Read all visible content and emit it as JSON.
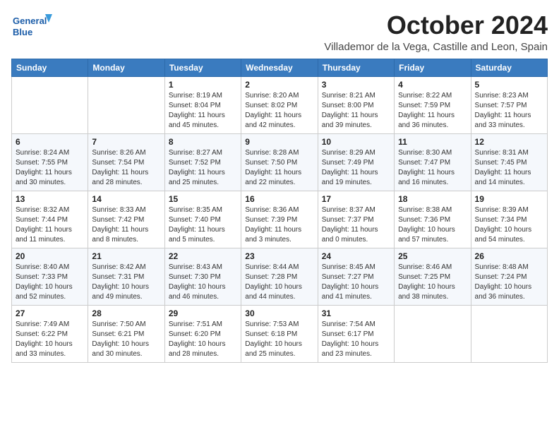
{
  "header": {
    "logo_text_general": "General",
    "logo_text_blue": "Blue",
    "month_title": "October 2024",
    "subtitle": "Villademor de la Vega, Castille and Leon, Spain"
  },
  "weekdays": [
    "Sunday",
    "Monday",
    "Tuesday",
    "Wednesday",
    "Thursday",
    "Friday",
    "Saturday"
  ],
  "weeks": [
    [
      {
        "day": "",
        "info": ""
      },
      {
        "day": "",
        "info": ""
      },
      {
        "day": "1",
        "info": "Sunrise: 8:19 AM\nSunset: 8:04 PM\nDaylight: 11 hours and 45 minutes."
      },
      {
        "day": "2",
        "info": "Sunrise: 8:20 AM\nSunset: 8:02 PM\nDaylight: 11 hours and 42 minutes."
      },
      {
        "day": "3",
        "info": "Sunrise: 8:21 AM\nSunset: 8:00 PM\nDaylight: 11 hours and 39 minutes."
      },
      {
        "day": "4",
        "info": "Sunrise: 8:22 AM\nSunset: 7:59 PM\nDaylight: 11 hours and 36 minutes."
      },
      {
        "day": "5",
        "info": "Sunrise: 8:23 AM\nSunset: 7:57 PM\nDaylight: 11 hours and 33 minutes."
      }
    ],
    [
      {
        "day": "6",
        "info": "Sunrise: 8:24 AM\nSunset: 7:55 PM\nDaylight: 11 hours and 30 minutes."
      },
      {
        "day": "7",
        "info": "Sunrise: 8:26 AM\nSunset: 7:54 PM\nDaylight: 11 hours and 28 minutes."
      },
      {
        "day": "8",
        "info": "Sunrise: 8:27 AM\nSunset: 7:52 PM\nDaylight: 11 hours and 25 minutes."
      },
      {
        "day": "9",
        "info": "Sunrise: 8:28 AM\nSunset: 7:50 PM\nDaylight: 11 hours and 22 minutes."
      },
      {
        "day": "10",
        "info": "Sunrise: 8:29 AM\nSunset: 7:49 PM\nDaylight: 11 hours and 19 minutes."
      },
      {
        "day": "11",
        "info": "Sunrise: 8:30 AM\nSunset: 7:47 PM\nDaylight: 11 hours and 16 minutes."
      },
      {
        "day": "12",
        "info": "Sunrise: 8:31 AM\nSunset: 7:45 PM\nDaylight: 11 hours and 14 minutes."
      }
    ],
    [
      {
        "day": "13",
        "info": "Sunrise: 8:32 AM\nSunset: 7:44 PM\nDaylight: 11 hours and 11 minutes."
      },
      {
        "day": "14",
        "info": "Sunrise: 8:33 AM\nSunset: 7:42 PM\nDaylight: 11 hours and 8 minutes."
      },
      {
        "day": "15",
        "info": "Sunrise: 8:35 AM\nSunset: 7:40 PM\nDaylight: 11 hours and 5 minutes."
      },
      {
        "day": "16",
        "info": "Sunrise: 8:36 AM\nSunset: 7:39 PM\nDaylight: 11 hours and 3 minutes."
      },
      {
        "day": "17",
        "info": "Sunrise: 8:37 AM\nSunset: 7:37 PM\nDaylight: 11 hours and 0 minutes."
      },
      {
        "day": "18",
        "info": "Sunrise: 8:38 AM\nSunset: 7:36 PM\nDaylight: 10 hours and 57 minutes."
      },
      {
        "day": "19",
        "info": "Sunrise: 8:39 AM\nSunset: 7:34 PM\nDaylight: 10 hours and 54 minutes."
      }
    ],
    [
      {
        "day": "20",
        "info": "Sunrise: 8:40 AM\nSunset: 7:33 PM\nDaylight: 10 hours and 52 minutes."
      },
      {
        "day": "21",
        "info": "Sunrise: 8:42 AM\nSunset: 7:31 PM\nDaylight: 10 hours and 49 minutes."
      },
      {
        "day": "22",
        "info": "Sunrise: 8:43 AM\nSunset: 7:30 PM\nDaylight: 10 hours and 46 minutes."
      },
      {
        "day": "23",
        "info": "Sunrise: 8:44 AM\nSunset: 7:28 PM\nDaylight: 10 hours and 44 minutes."
      },
      {
        "day": "24",
        "info": "Sunrise: 8:45 AM\nSunset: 7:27 PM\nDaylight: 10 hours and 41 minutes."
      },
      {
        "day": "25",
        "info": "Sunrise: 8:46 AM\nSunset: 7:25 PM\nDaylight: 10 hours and 38 minutes."
      },
      {
        "day": "26",
        "info": "Sunrise: 8:48 AM\nSunset: 7:24 PM\nDaylight: 10 hours and 36 minutes."
      }
    ],
    [
      {
        "day": "27",
        "info": "Sunrise: 7:49 AM\nSunset: 6:22 PM\nDaylight: 10 hours and 33 minutes."
      },
      {
        "day": "28",
        "info": "Sunrise: 7:50 AM\nSunset: 6:21 PM\nDaylight: 10 hours and 30 minutes."
      },
      {
        "day": "29",
        "info": "Sunrise: 7:51 AM\nSunset: 6:20 PM\nDaylight: 10 hours and 28 minutes."
      },
      {
        "day": "30",
        "info": "Sunrise: 7:53 AM\nSunset: 6:18 PM\nDaylight: 10 hours and 25 minutes."
      },
      {
        "day": "31",
        "info": "Sunrise: 7:54 AM\nSunset: 6:17 PM\nDaylight: 10 hours and 23 minutes."
      },
      {
        "day": "",
        "info": ""
      },
      {
        "day": "",
        "info": ""
      }
    ]
  ]
}
